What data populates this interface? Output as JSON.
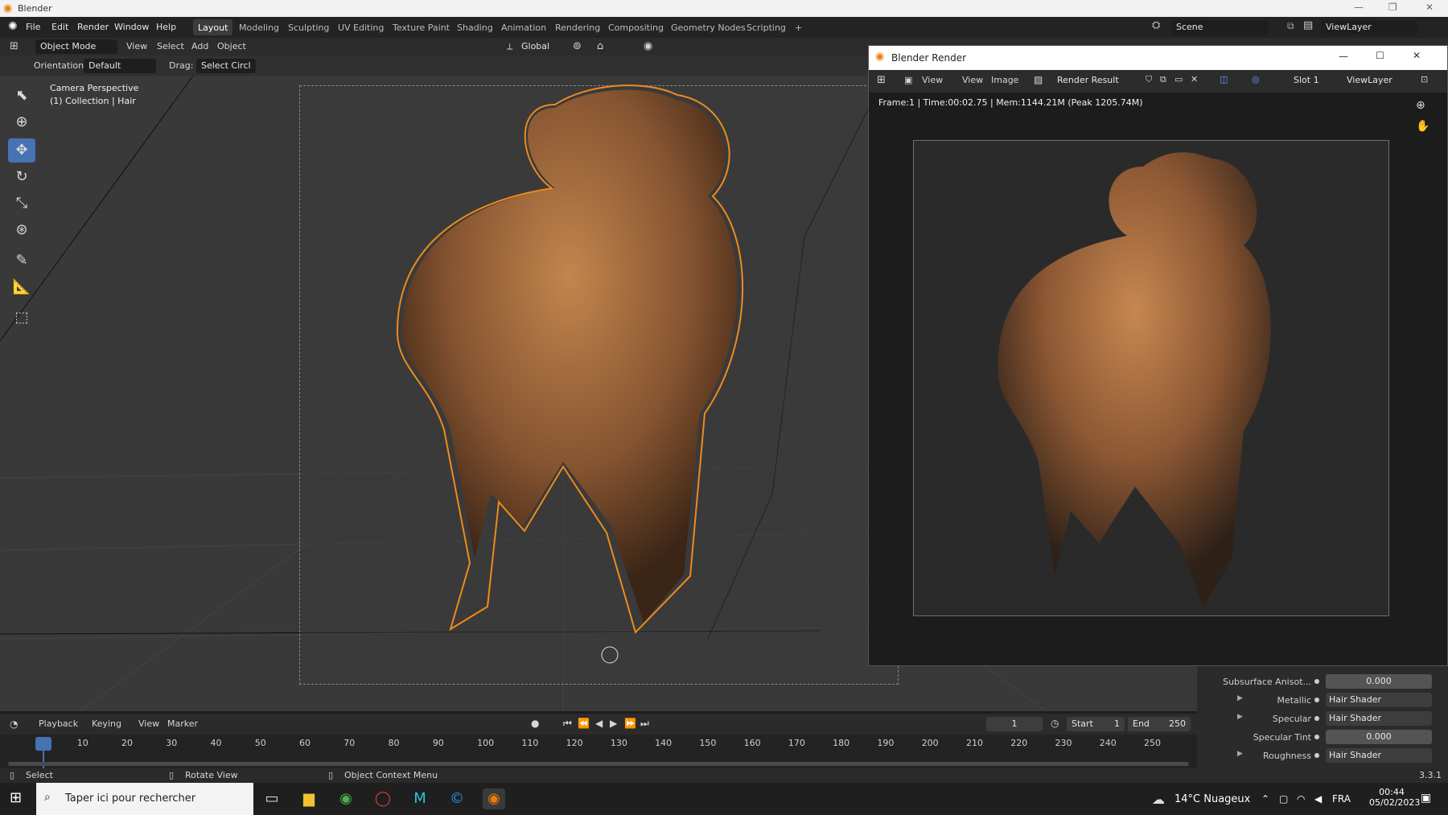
{
  "window": {
    "title": "Blender"
  },
  "menu": [
    "File",
    "Edit",
    "Render",
    "Window",
    "Help"
  ],
  "workspaces": [
    "Layout",
    "Modeling",
    "Sculpting",
    "UV Editing",
    "Texture Paint",
    "Shading",
    "Animation",
    "Rendering",
    "Compositing",
    "Geometry Nodes",
    "Scripting",
    "+"
  ],
  "scene": {
    "scene_name": "Scene",
    "view_layer": "ViewLayer"
  },
  "viewport_header": {
    "mode": "Object Mode",
    "view": "View",
    "select": "Select",
    "add": "Add",
    "object": "Object",
    "transform": "Global"
  },
  "tool_settings": {
    "orientation_label": "Orientation:",
    "orientation_value": "Default",
    "drag_label": "Drag:",
    "drag_value": "Select Circl"
  },
  "viewport_overlay": {
    "line1": "Camera Perspective",
    "line2": "(1) Collection | Hair"
  },
  "render_window": {
    "title": "Blender Render",
    "view": "View",
    "view2": "View",
    "image": "Image",
    "image_name": "Render Result",
    "slot": "Slot 1",
    "layer": "ViewLayer",
    "stats": "Frame:1 | Time:00:02.75 | Mem:1144.21M (Peak 1205.74M)"
  },
  "properties": [
    {
      "label": "Subsurface Anisot...",
      "value": "0.000",
      "kind": "num"
    },
    {
      "label": "Metallic",
      "value": "Hair Shader",
      "kind": "link"
    },
    {
      "label": "Specular",
      "value": "Hair Shader",
      "kind": "link"
    },
    {
      "label": "Specular Tint",
      "value": "0.000",
      "kind": "num"
    },
    {
      "label": "Roughness",
      "value": "Hair Shader",
      "kind": "link"
    }
  ],
  "timeline": {
    "playback": "Playback",
    "keying": "Keying",
    "view": "View",
    "marker": "Marker",
    "current_frame": "1",
    "start_label": "Start",
    "start": "1",
    "end_label": "End",
    "end": "250",
    "ticks": [
      "1",
      "10",
      "20",
      "30",
      "40",
      "50",
      "60",
      "70",
      "80",
      "90",
      "100",
      "110",
      "120",
      "130",
      "140",
      "150",
      "160",
      "170",
      "180",
      "190",
      "200",
      "210",
      "220",
      "230",
      "240",
      "250"
    ]
  },
  "statusbar": {
    "select": "Select",
    "rotate": "Rotate View",
    "context": "Object Context Menu",
    "version": "3.3.1"
  },
  "taskbar": {
    "search_placeholder": "Taper ici pour rechercher",
    "weather": "14°C Nuageux",
    "lang": "FRA",
    "time": "00:44",
    "date": "05/02/2023"
  }
}
